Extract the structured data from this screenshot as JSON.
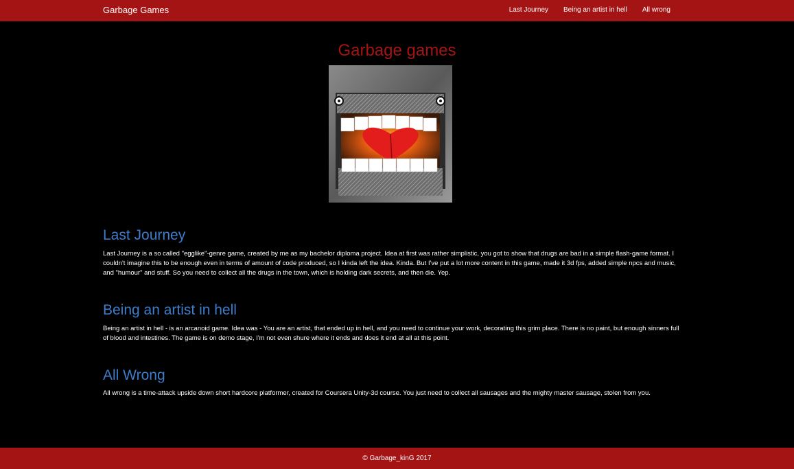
{
  "nav": {
    "brand": "Garbage Games",
    "links": [
      "Last Journey",
      "Being an artist in hell",
      "All wrong"
    ]
  },
  "site_title": "Garbage games",
  "hero_image": {
    "icon": "garbage-monster-mouth-image"
  },
  "sections": [
    {
      "title": "Last Journey",
      "text": "Last Journey is a so called \"egglike\"-genre game, created by me as my bachelor diploma project. Idea at first was rather simplistic, you got to show that drugs are bad in a simple flash-game format. I couldn't imagine this to be enough even in terms of amount of code produced, so I kinda left the idea. Kinda. But I've put a lot more content in this game, made it 3d fps, added simple npcs and music, and \"humour\" and stuff. So you need to collect all the drugs in the town, which is holding dark secrets, and then die. Yep."
    },
    {
      "title": "Being an artist in hell",
      "text": "Being an artist in hell - is an arcanoid game. Idea was - You are an artist, that ended up in hell, and you need to continue your work, decorating this grim place. There is no paint, but enough sinners full of blood and intestines. The game is on demo stage, I'm not even shure where it ends and does it end at all at this point."
    },
    {
      "title": "All Wrong",
      "text": "All wrong is a time-attack upside down short hardcore platformer, created for Coursera Unity-3d course. You just need to collect all sausages and the mighty master sausage, stolen from you."
    }
  ],
  "footer": {
    "text": "© Garbage_kinG 2017"
  },
  "colors": {
    "accent": "#a51414",
    "heading": "#3d7dcb",
    "background": "#000000"
  }
}
